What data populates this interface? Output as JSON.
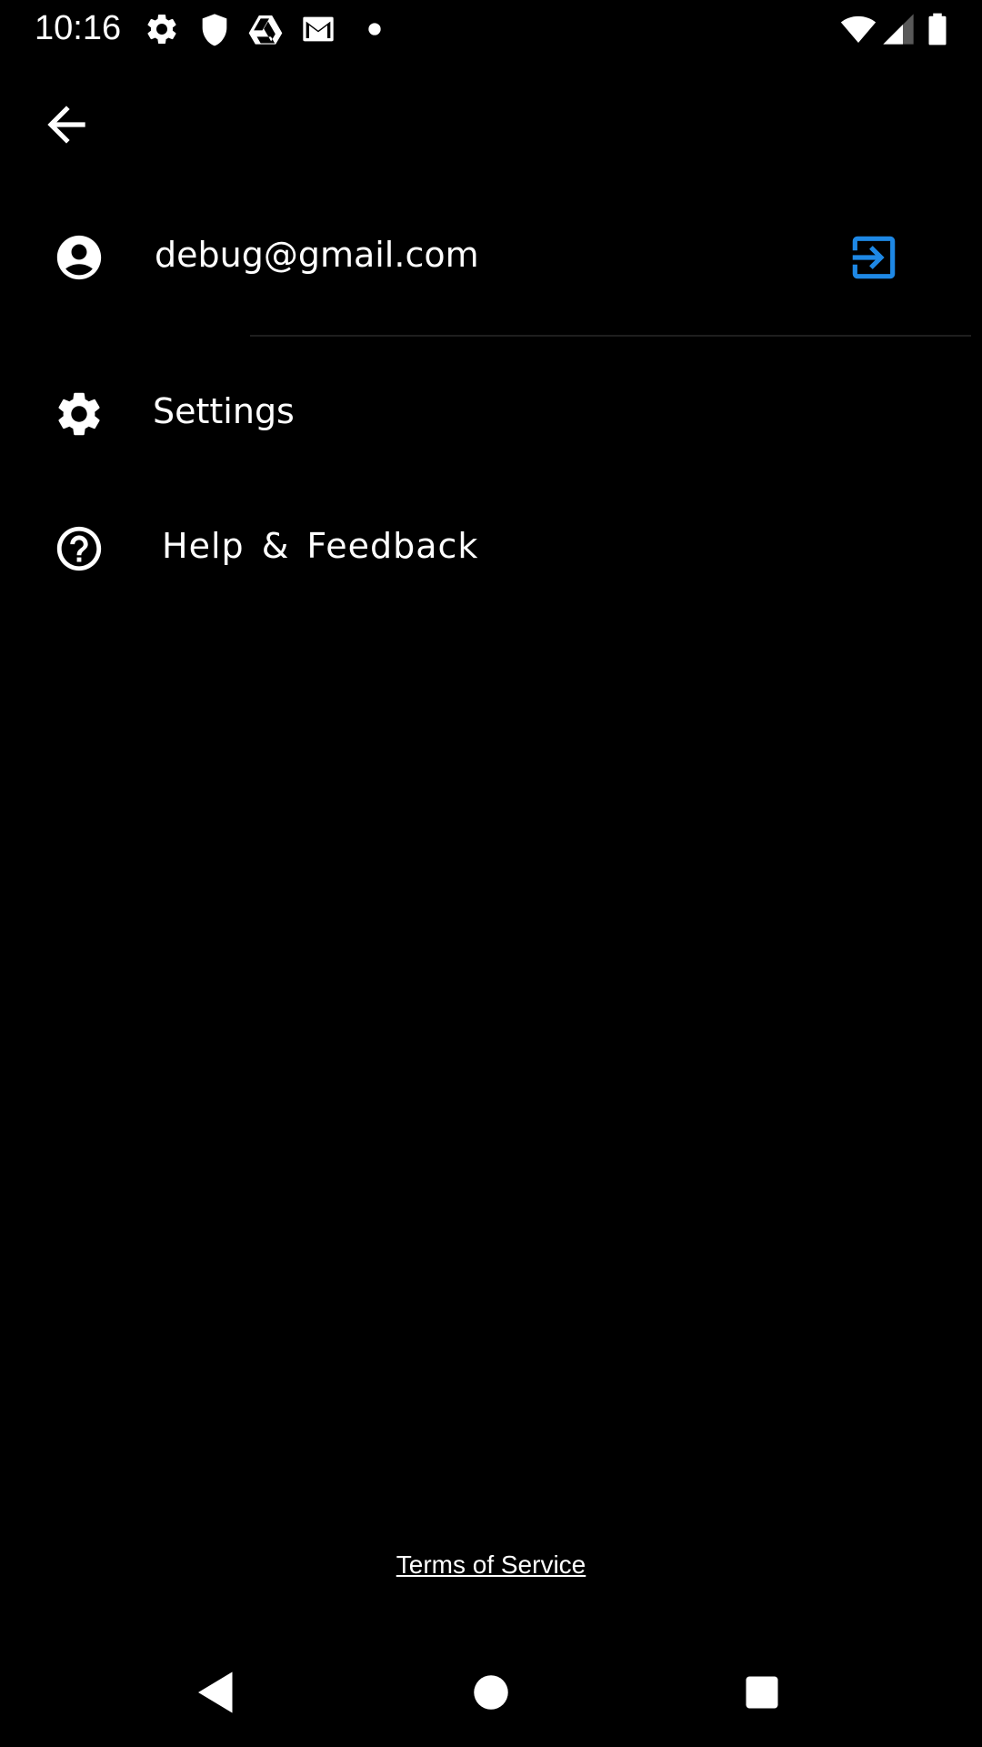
{
  "status_bar": {
    "time": "10:16",
    "left_icons": [
      "gear-icon",
      "shield-icon",
      "drive-icon",
      "gmail-icon",
      "dot-icon"
    ],
    "right_icons": [
      "wifi-icon",
      "cell-signal-icon",
      "battery-icon"
    ]
  },
  "header": {
    "back_icon": "arrow-back-icon"
  },
  "account": {
    "email": "debug@gmail.com",
    "icon": "account-circle-icon",
    "action_icon": "sign-in-icon",
    "action_color": "#1e88e5"
  },
  "menu": {
    "items": [
      {
        "label": "Settings",
        "icon": "gear-icon"
      },
      {
        "label": "Help & Feedback",
        "icon": "help-circle-icon"
      }
    ]
  },
  "footer": {
    "terms_label": "Terms of Service"
  },
  "nav_bar": {
    "buttons": [
      "back-triangle-icon",
      "home-circle-icon",
      "recents-square-icon"
    ],
    "color": "#ffffff"
  }
}
